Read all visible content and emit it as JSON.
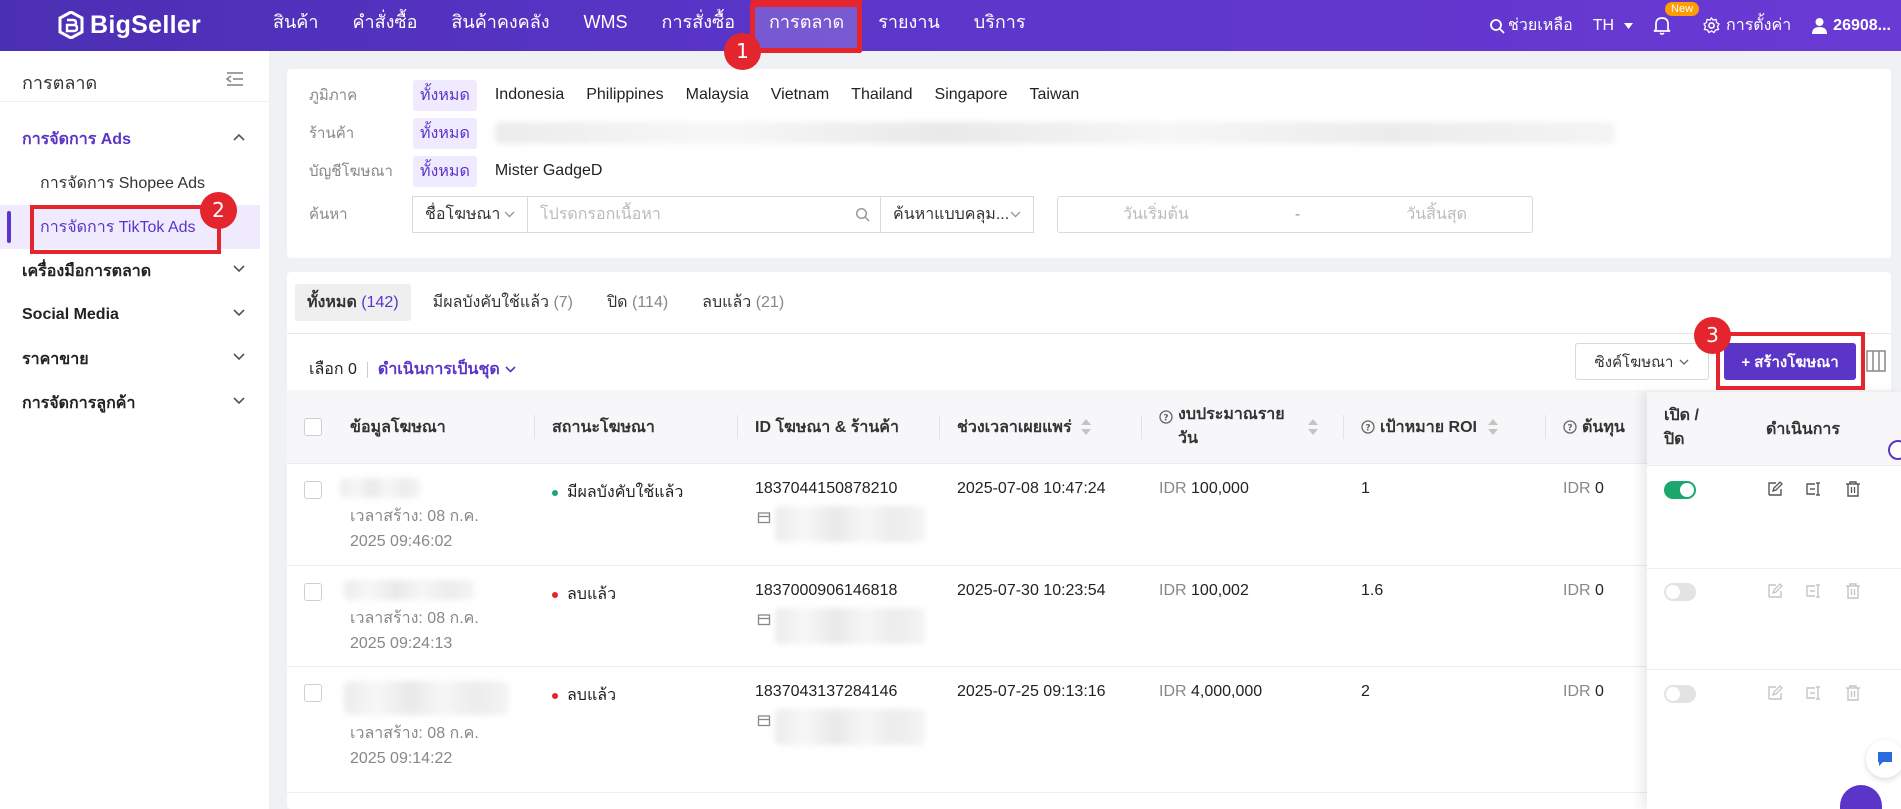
{
  "brand": {
    "name": "BigSeller"
  },
  "nav": {
    "items": [
      "สินค้า",
      "คำสั่งซื้อ",
      "สินค้าคงคลัง",
      "WMS",
      "การสั่งซื้อ",
      "การตลาด",
      "รายงาน",
      "บริการ"
    ],
    "active": "การตลาด"
  },
  "topright": {
    "help": "ช่วยเหลือ",
    "lang": "TH",
    "new_badge": "New",
    "settings": "การตั้งค่า",
    "user": "26908..."
  },
  "markers": [
    "1",
    "2",
    "3"
  ],
  "sidebar": {
    "title": "การตลาด",
    "groups": [
      {
        "label": "การจัดการ Ads",
        "subs": [
          "การจัดการ Shopee Ads",
          "การจัดการ TikTok Ads"
        ]
      },
      {
        "label": "เครื่องมือการตลาด"
      },
      {
        "label": "Social Media"
      },
      {
        "label": "ราคาขาย"
      },
      {
        "label": "การจัดการลูกค้า"
      }
    ]
  },
  "filters": {
    "region_label": "ภูมิภาค",
    "all": "ทั้งหมด",
    "regions": [
      "Indonesia",
      "Philippines",
      "Malaysia",
      "Vietnam",
      "Thailand",
      "Singapore",
      "Taiwan"
    ],
    "shop_label": "ร้านค้า",
    "account_label": "บัญชีโฆษณา",
    "account": "Mister GadgeD",
    "search_label": "ค้นหา",
    "search_field": "ชื่อโฆษณา",
    "search_placeholder": "โปรดกรอกเนื้อหา",
    "search_mode": "ค้นหาแบบคลุม...",
    "date_start": "วันเริ่มต้น",
    "date_sep": "-",
    "date_end": "วันสิ้นสุด"
  },
  "tabs": [
    {
      "label": "ทั้งหมด",
      "count": "(142)"
    },
    {
      "label": "มีผลบังคับใช้แล้ว",
      "count": "(7)"
    },
    {
      "label": "ปิด",
      "count": "(114)"
    },
    {
      "label": "ลบแล้ว",
      "count": "(21)"
    }
  ],
  "toolbar": {
    "selected": "เลือก 0",
    "bulk": "ดำเนินการเป็นชุด",
    "sync": "ซิงค์โฆษณา",
    "create": "+ สร้างโฆษณา"
  },
  "columns": {
    "info": "ข้อมูลโฆษณา",
    "status": "สถานะโฆษณา",
    "id": "ID โฆษณา & ร้านค้า",
    "period": "ช่วงเวลาเผยแพร่",
    "budget_1": "งบประมาณราย",
    "budget_2": "วัน",
    "roi": "เป้าหมาย ROI",
    "cost": "ต้นทุน",
    "toggle_1": "เปิด /",
    "toggle_2": "ปิด",
    "actions": "ดำเนินการ"
  },
  "colors": {
    "accent": "#5a35c8",
    "active_status": "#1aa86c",
    "deleted_status": "#e4252d",
    "marker": "#e4252d"
  },
  "rows": [
    {
      "created_1": "เวลาสร้าง: 08 ก.ค.",
      "created_2": "2025 09:46:02",
      "status": "มีผลบังคับใช้แล้ว",
      "status_kind": "active",
      "ad_id": "1837044150878210",
      "period": "2025-07-08 10:47:24",
      "budget_cur": "IDR",
      "budget": "100,000",
      "roi": "1",
      "cost_cur": "IDR",
      "cost": "0",
      "enabled": true
    },
    {
      "created_1": "เวลาสร้าง: 08 ก.ค.",
      "created_2": "2025 09:24:13",
      "status": "ลบแล้ว",
      "status_kind": "deleted",
      "ad_id": "1837000906146818",
      "period": "2025-07-30 10:23:54",
      "budget_cur": "IDR",
      "budget": "100,002",
      "roi": "1.6",
      "cost_cur": "IDR",
      "cost": "0",
      "enabled": false
    },
    {
      "created_1": "เวลาสร้าง: 08 ก.ค.",
      "created_2": "2025 09:14:22",
      "status": "ลบแล้ว",
      "status_kind": "deleted",
      "ad_id": "1837043137284146",
      "period": "2025-07-25 09:13:16",
      "budget_cur": "IDR",
      "budget": "4,000,000",
      "roi": "2",
      "cost_cur": "IDR",
      "cost": "0",
      "enabled": false
    }
  ]
}
